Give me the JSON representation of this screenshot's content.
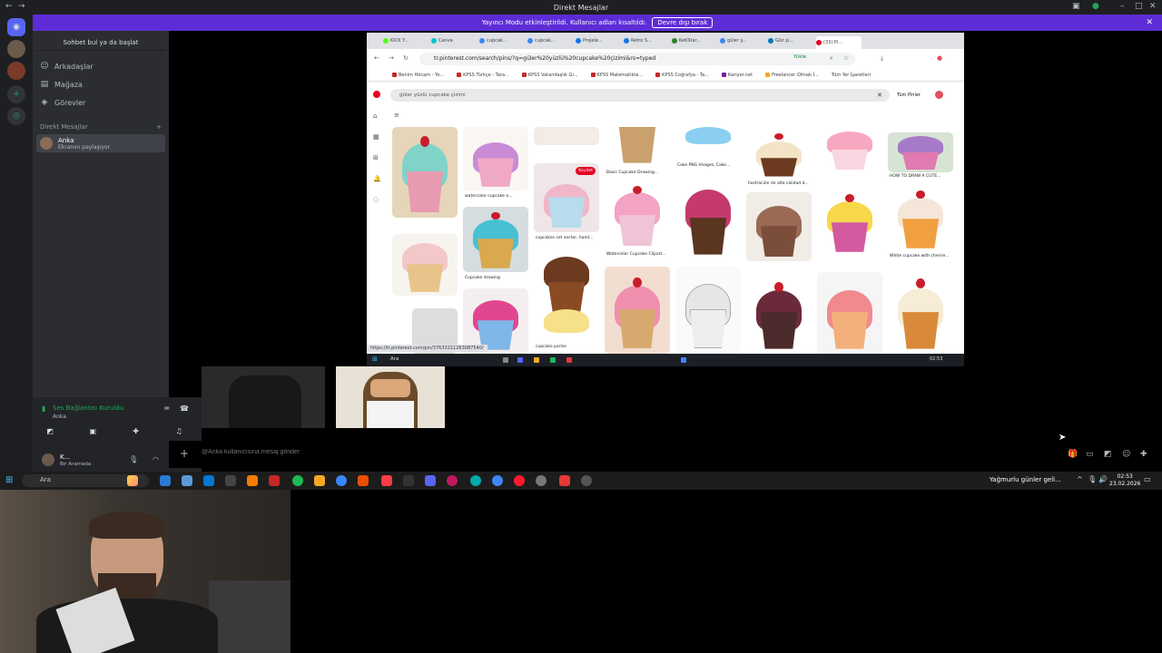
{
  "window": {
    "title": "Direkt Mesajlar"
  },
  "banner": {
    "text": "Yayıncı Modu etkinleştirildi. Kullanıcı adları kısaltıldı.",
    "button": "Devre dışı bırak"
  },
  "sidebar": {
    "search": "Sohbet bul ya da başlat",
    "nav": [
      {
        "label": "Arkadaşlar",
        "icon": "friends-icon"
      },
      {
        "label": "Mağaza",
        "icon": "shop-icon"
      },
      {
        "label": "Görevler",
        "icon": "quests-icon"
      }
    ],
    "dm_header": "Direkt Mesajlar",
    "dm": {
      "name": "Anka",
      "status": "Ekranını paylaşıyor"
    }
  },
  "voice": {
    "status": "Ses Bağlantısı Kuruldu",
    "channel": "Anka"
  },
  "user": {
    "name": "K...",
    "status": "Bir Aramada"
  },
  "composer": {
    "placeholder": "@Anka kullanıcısına mesaj gönder"
  },
  "stream": {
    "tabs": [
      "KICK Y...",
      "Canva",
      "cupcak...",
      "cupcak...",
      "Projele...",
      "Retro S...",
      "KeKStar...",
      "güler y...",
      "Göz şi...",
      "(33) Pi..."
    ],
    "url": "tr.pinterest.com/search/pins/?q=güler%20yüzlü%20cupcake%20çizimi&rs=typed",
    "install": "Yükle",
    "bookmarks": [
      "Benim Hocam - Yo...",
      "KPSS Türkçe - Tara...",
      "KPSS Vatandaşlık Gi...",
      "KPSS Matematikte...",
      "KPSS Coğrafya - Ta...",
      "Kariyer.net",
      "Freelancer Olmak İ...",
      "Tüm Yer İşaretleri"
    ],
    "search_query": "güler yüzlü cupcake çizimi",
    "filter": "Tüm Pinler",
    "save_label": "Kaydet",
    "pin_labels": [
      "watercolor cupcake a...",
      "cupcakes set vector, hand...",
      "Cupcake drawing",
      "Basic Cupcake Drawing...",
      "Cake PNG Images, Cake...",
      "Ilustración de alta calidad d...",
      "HOW TO DRAW A CUTE...",
      "Watercolor Cupcake Clipart...",
      "White cupcake with cherrie...",
      "cupcake parlse"
    ],
    "status_url": "https://tr.pinterest.com/pin/37633211263087540/",
    "taskbar_search": "Ara",
    "time": "02:53"
  },
  "taskbar": {
    "search": "Ara",
    "weather": "Yağmurlu günler geli...",
    "time": "02:53",
    "date": "23.02.2026"
  },
  "colors": {
    "accent": "#5d2cd6",
    "discord": "#5865f2",
    "pinterest": "#e60023",
    "green": "#23a55a"
  }
}
